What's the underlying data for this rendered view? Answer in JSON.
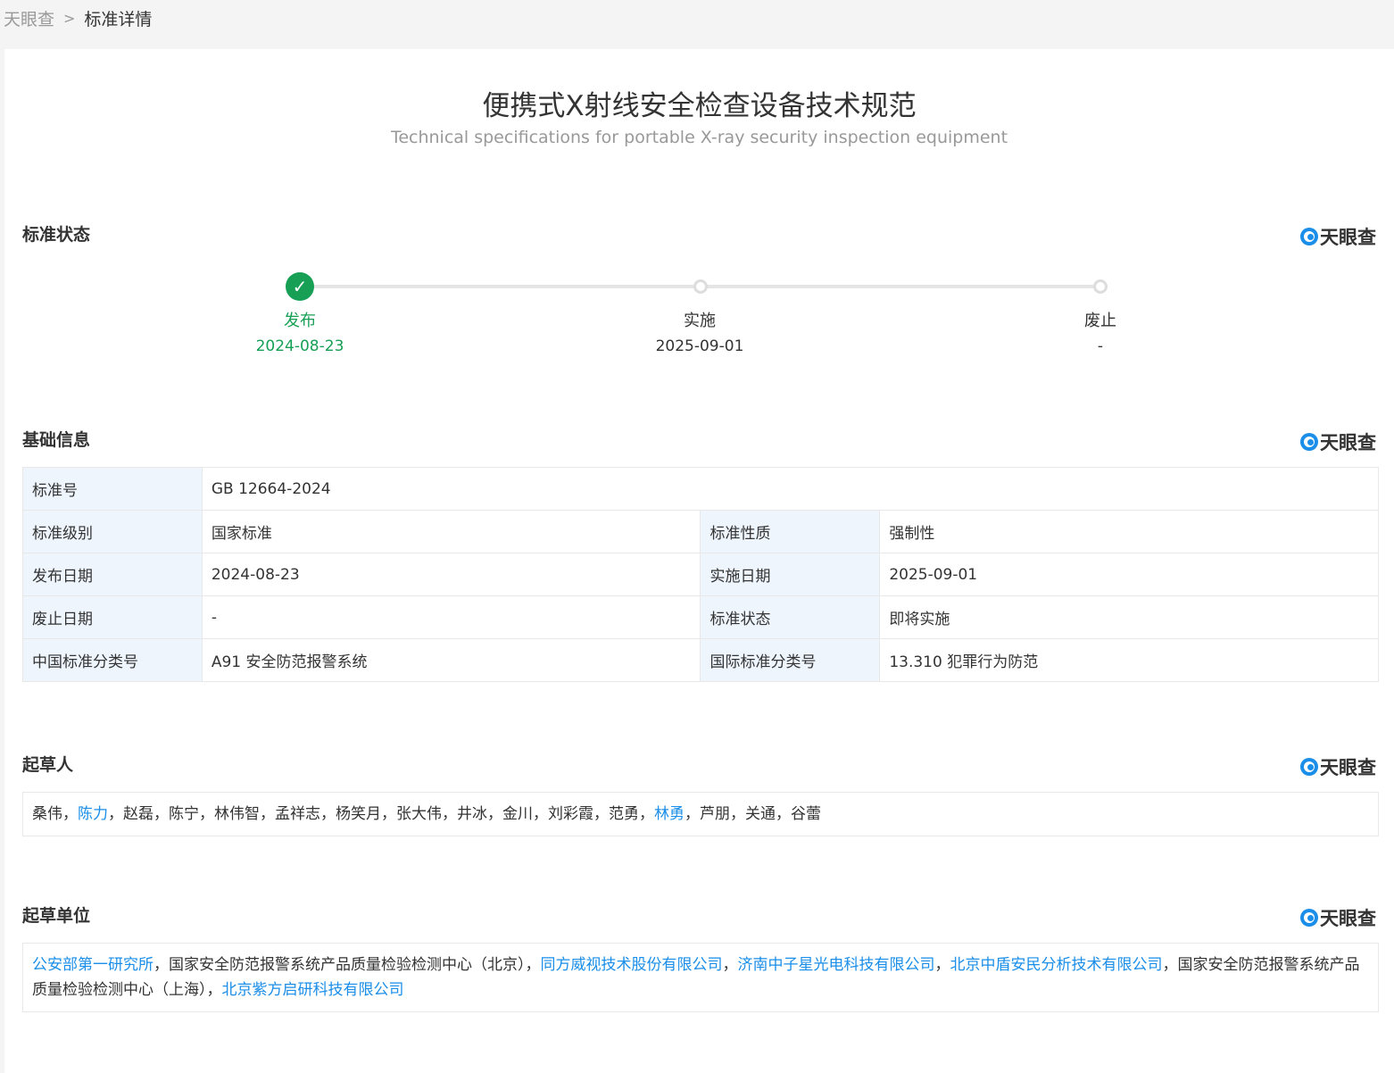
{
  "breadcrumb": {
    "home": "天眼查",
    "current": "标准详情"
  },
  "title": {
    "zh": "便携式X射线安全检查设备技术规范",
    "en": "Technical specifications for portable X-ray security inspection equipment"
  },
  "brand": {
    "name": "天眼查"
  },
  "sections": {
    "status": "标准状态",
    "basic": "基础信息",
    "drafters": "起草人",
    "units": "起草单位"
  },
  "timeline": {
    "steps": [
      {
        "label": "发布",
        "date": "2024-08-23"
      },
      {
        "label": "实施",
        "date": "2025-09-01"
      },
      {
        "label": "废止",
        "date": "-"
      }
    ]
  },
  "info": {
    "std_no": {
      "label": "标准号",
      "value": "GB 12664-2024"
    },
    "level": {
      "label": "标准级别",
      "value": "国家标准"
    },
    "nature": {
      "label": "标准性质",
      "value": "强制性"
    },
    "pub_date": {
      "label": "发布日期",
      "value": "2024-08-23"
    },
    "impl_date": {
      "label": "实施日期",
      "value": "2025-09-01"
    },
    "abolish_date": {
      "label": "废止日期",
      "value": "-"
    },
    "status": {
      "label": "标准状态",
      "value": "即将实施"
    },
    "ccs": {
      "label": "中国标准分类号",
      "value": "A91 安全防范报警系统"
    },
    "ics": {
      "label": "国际标准分类号",
      "value": "13.310 犯罪行为防范"
    }
  },
  "drafters": [
    {
      "name": "桑伟",
      "link": false
    },
    {
      "name": "陈力",
      "link": true
    },
    {
      "name": "赵磊",
      "link": false
    },
    {
      "name": "陈宁",
      "link": false
    },
    {
      "name": "林伟智",
      "link": false
    },
    {
      "name": "孟祥志",
      "link": false
    },
    {
      "name": "杨笑月",
      "link": false
    },
    {
      "name": "张大伟",
      "link": false
    },
    {
      "name": "井冰",
      "link": false
    },
    {
      "name": "金川",
      "link": false
    },
    {
      "name": "刘彩霞",
      "link": false
    },
    {
      "name": "范勇",
      "link": false
    },
    {
      "name": "林勇",
      "link": true
    },
    {
      "name": "芦朋",
      "link": false
    },
    {
      "name": "关通",
      "link": false
    },
    {
      "name": "谷蕾",
      "link": false
    }
  ],
  "units": [
    {
      "name": "公安部第一研究所",
      "link": true
    },
    {
      "name": "国家安全防范报警系统产品质量检验检测中心（北京）",
      "link": false
    },
    {
      "name": "同方威视技术股份有限公司",
      "link": true
    },
    {
      "name": "济南中子星光电科技有限公司",
      "link": true
    },
    {
      "name": "北京中盾安民分析技术有限公司",
      "link": true
    },
    {
      "name": "国家安全防范报警系统产品质量检验检测中心（上海）",
      "link": false
    },
    {
      "name": "北京紫方启研科技有限公司",
      "link": true
    }
  ]
}
